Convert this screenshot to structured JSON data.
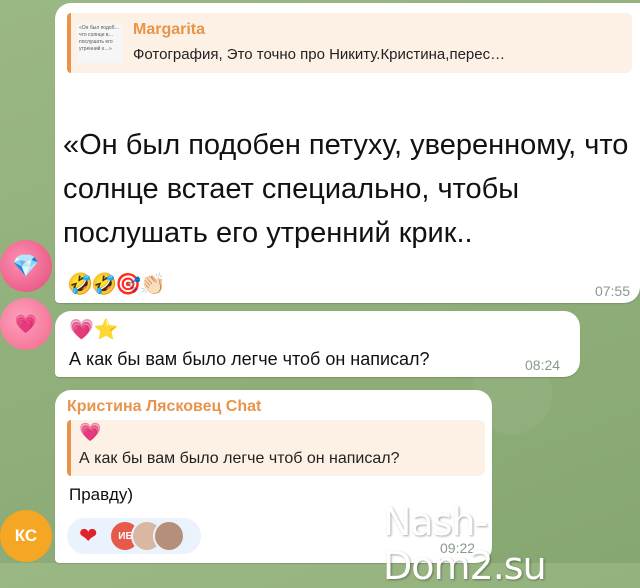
{
  "colors": {
    "accent": "#e8944a",
    "bubble": "#ffffff",
    "background": "#8fae7a"
  },
  "messages": [
    {
      "avatar": {
        "text": "",
        "icon": "diamond-heart-avatar",
        "color": "#f06a8a"
      },
      "reply": {
        "name": "Margarita",
        "snippet": "Фотография, Это точно про Никиту.Кристина,перес…",
        "thumb_text": "«Он был подоб… что солнце в… послушать его утренний к…»"
      },
      "quote": "«Он был подобен петуху, уверенному, что солнце встает специально, чтобы послушать его утренний крик..",
      "reactions": "🤣🤣🎯👏🏻",
      "time": "07:55"
    },
    {
      "avatar": {
        "text": "",
        "icon": "pink-heart-avatar",
        "color": "#f06a8a"
      },
      "emoji": "💗⭐",
      "text": "А как бы вам было легче чтоб он написал?",
      "time": "08:24"
    },
    {
      "avatar": {
        "text": "КС",
        "color": "#f5a623"
      },
      "sender": "Кристина Лясковец Chat",
      "reply": {
        "emoji": "💗",
        "text": "А как бы вам было легче чтоб он написал?"
      },
      "text": "Правду)",
      "reactions": {
        "heart": "❤",
        "mini_avatar": "ИБ"
      },
      "time": "09:22"
    }
  ],
  "watermark": "Nash-Dom2.su"
}
